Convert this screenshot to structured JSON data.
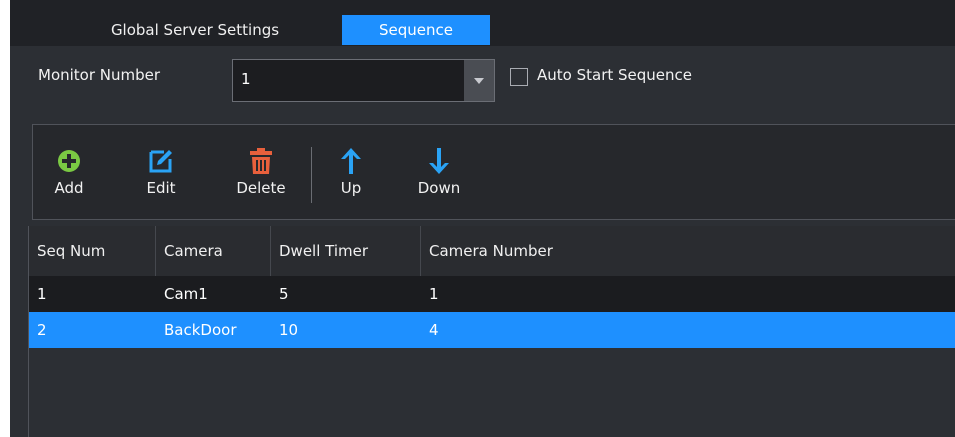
{
  "tabs": [
    "Global Server Settings",
    "Sequence"
  ],
  "monitor": {
    "label": "Monitor Number",
    "value": "1",
    "auto_start_label": "Auto Start Sequence",
    "auto_start_checked": false
  },
  "toolbar": {
    "add": "Add",
    "edit": "Edit",
    "delete": "Delete",
    "up": "Up",
    "down": "Down"
  },
  "colors": {
    "accent": "#1e90ff",
    "add_icon": "#7ac943",
    "edit_icon": "#2aa3f5",
    "delete_icon": "#e8603c",
    "arrow_icon": "#2aa3f5"
  },
  "grid": {
    "columns": [
      "Seq Num",
      "Camera",
      "Dwell Timer",
      "Camera Number"
    ],
    "rows": [
      [
        "1",
        "Cam1",
        "5",
        "1"
      ],
      [
        "2",
        "BackDoor",
        "10",
        "4"
      ]
    ],
    "selected_row": 1
  }
}
